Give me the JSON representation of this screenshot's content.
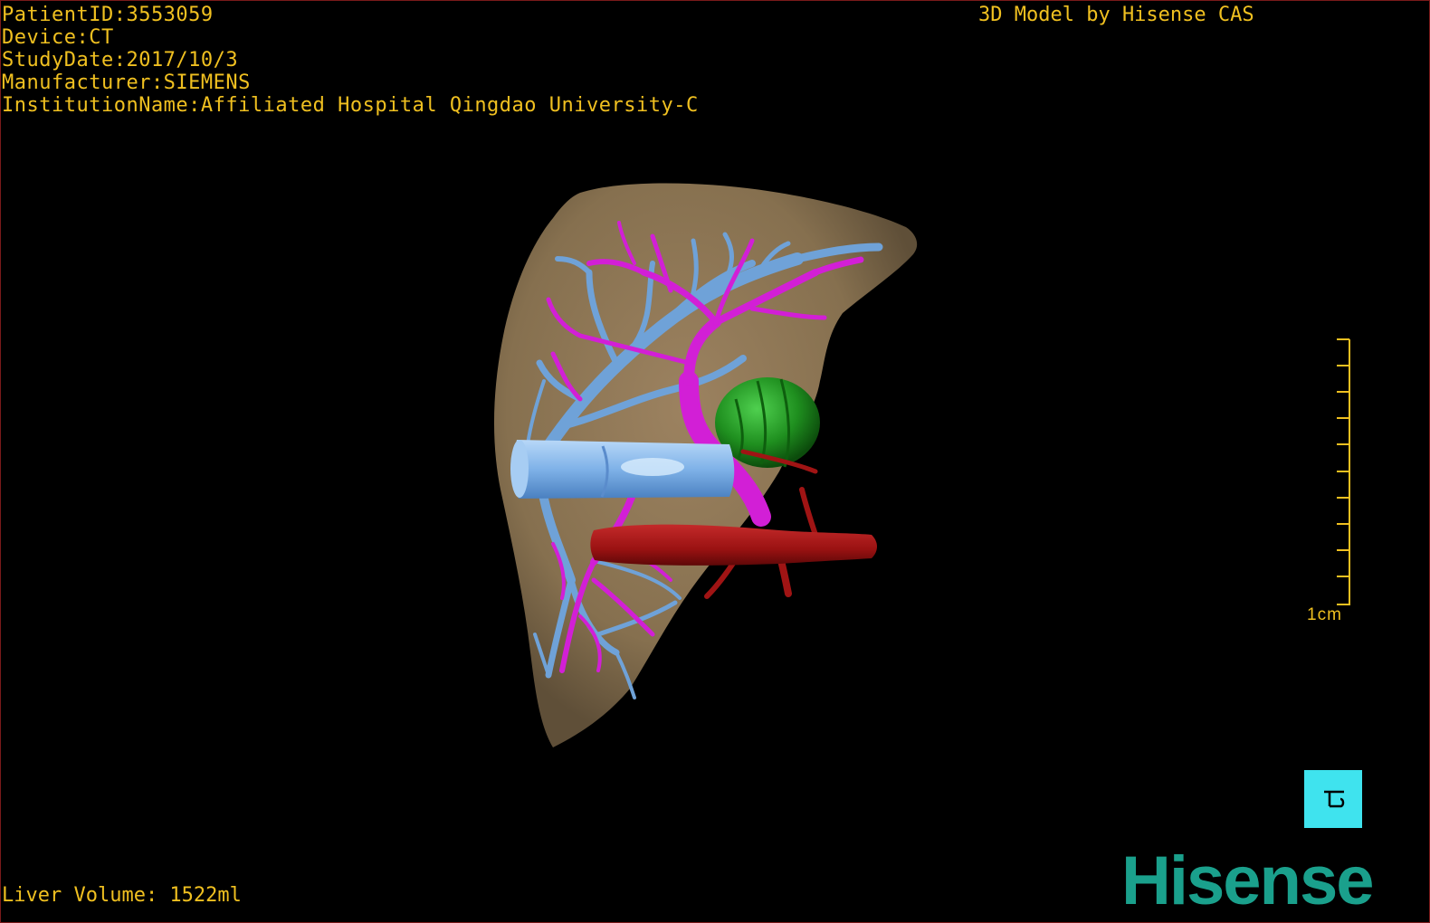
{
  "header": {
    "patient_id": "PatientID:3553059",
    "device": "Device:CT",
    "study_date": "StudyDate:2017/10/3",
    "manufacturer": "Manufacturer:SIEMENS",
    "institution": "InstitutionName:Affiliated Hospital Qingdao University-C"
  },
  "model_credit": "3D Model by Hisense CAS",
  "footer": {
    "liver_volume": "Liver Volume: 1522ml"
  },
  "scale": {
    "label": "1cm"
  },
  "brand": {
    "name": "Hisense"
  },
  "colors": {
    "overlay_text": "#f0c020",
    "liver": "#8c7352",
    "portal_vein": "#6fa2d8",
    "hepatic_artery": "#d21fd6",
    "aorta": "#a01414",
    "tumor": "#1f8f1f",
    "brand": "#1aa08c",
    "orientation_cube": "#3fe3ee"
  },
  "icons": {
    "orientation_cube": "orientation-cube-icon"
  }
}
